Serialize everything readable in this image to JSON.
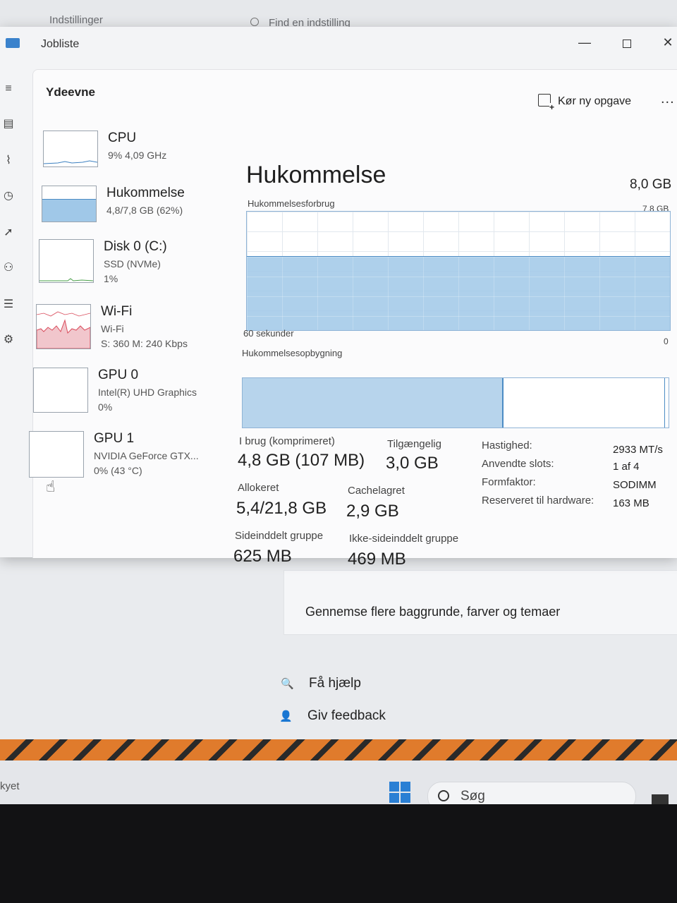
{
  "settings": {
    "title": "Indstillinger",
    "search_placeholder": "Find en indstilling",
    "card_text": "Gennemse flere baggrunde, farver og temaer",
    "help_label": "Få hjælp",
    "feedback_label": "Giv feedback"
  },
  "taskmanager": {
    "window_title": "Jobliste",
    "page_title": "Ydeevne",
    "new_task_label": "Kør ny opgave",
    "more_label": "...",
    "devices": [
      {
        "name": "CPU",
        "line2": "9% 4,09 GHz",
        "line3": ""
      },
      {
        "name": "Hukommelse",
        "line2": "4,8/7,8 GB (62%)",
        "line3": ""
      },
      {
        "name": "Disk 0 (C:)",
        "line2": "SSD (NVMe)",
        "line3": "1%"
      },
      {
        "name": "Wi-Fi",
        "line2": "Wi-Fi",
        "line3": "S: 360 M: 240 Kbps"
      },
      {
        "name": "GPU 0",
        "line2": "Intel(R) UHD Graphics",
        "line3": "0%"
      },
      {
        "name": "GPU 1",
        "line2": "NVIDIA GeForce GTX...",
        "line3": "0% (43 °C)"
      }
    ],
    "memory": {
      "heading": "Hukommelse",
      "total": "8,0 GB",
      "usage_label": "Hukommelsesforbrug",
      "usage_max": "7,8 GB",
      "usage_fraction": 0.62,
      "time_label": "60 sekunder",
      "zero_label": "0",
      "composition_label": "Hukommelsesopbygning",
      "composition_used_fraction": 0.61,
      "composition_modified_fraction": 0.99,
      "stats": {
        "in_use_label": "I brug (komprimeret)",
        "in_use_value": "4,8 GB (107 MB)",
        "available_label": "Tilgængelig",
        "available_value": "3,0 GB",
        "committed_label": "Allokeret",
        "committed_value": "5,4/21,8 GB",
        "cached_label": "Cachelagret",
        "cached_value": "2,9 GB",
        "paged_label": "Sideinddelt gruppe",
        "paged_value": "625 MB",
        "nonpaged_label": "Ikke-sideinddelt gruppe",
        "nonpaged_value": "469 MB"
      },
      "specs": {
        "speed_label": "Hastighed:",
        "speed_value": "2933 MT/s",
        "slots_label": "Anvendte slots:",
        "slots_value": "1 af 4",
        "form_label": "Formfaktor:",
        "form_value": "SODIMM",
        "reserved_label": "Reserveret til hardware:",
        "reserved_value": "163 MB"
      }
    }
  },
  "taskbar": {
    "left_text": "kyet",
    "search_label": "Søg"
  },
  "colors": {
    "memory_fill": "#a0c8e8",
    "memory_border": "#4c8cc4",
    "wifi_graph": "#d94a5a",
    "windows_blue": "#2a7fd4"
  }
}
